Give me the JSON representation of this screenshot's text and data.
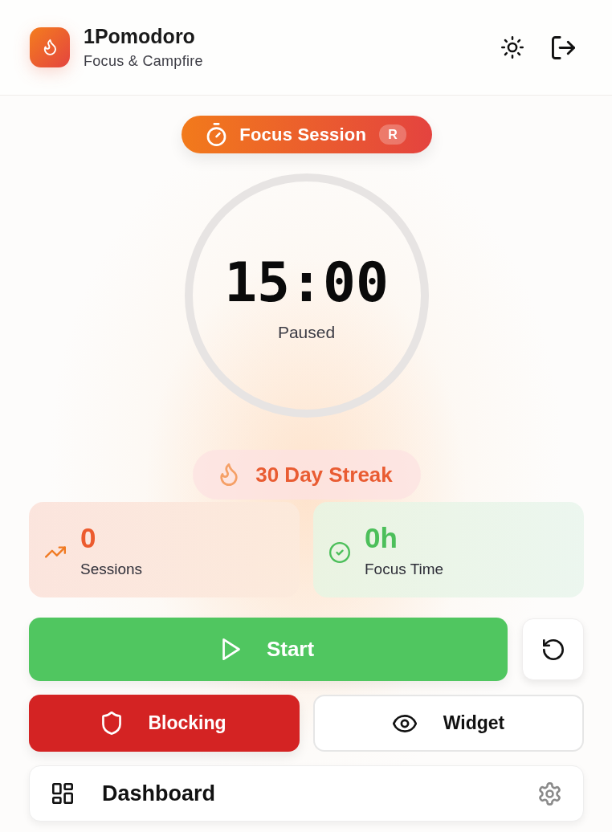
{
  "header": {
    "title": "1Pomodoro",
    "subtitle": "Focus & Campfire"
  },
  "session": {
    "label": "Focus Session",
    "badge": "R"
  },
  "timer": {
    "time": "15:00",
    "status": "Paused"
  },
  "streak": {
    "label": "30 Day Streak"
  },
  "stats": [
    {
      "kind": "sessions",
      "value": "0",
      "label": "Sessions"
    },
    {
      "kind": "focus",
      "value": "0h",
      "label": "Focus Time"
    }
  ],
  "start": {
    "label": "Start"
  },
  "toggles": [
    {
      "kind": "blocking",
      "label": "Blocking",
      "active": true
    },
    {
      "kind": "widget",
      "label": "Widget",
      "active": false
    }
  ],
  "dashboard": {
    "label": "Dashboard"
  }
}
